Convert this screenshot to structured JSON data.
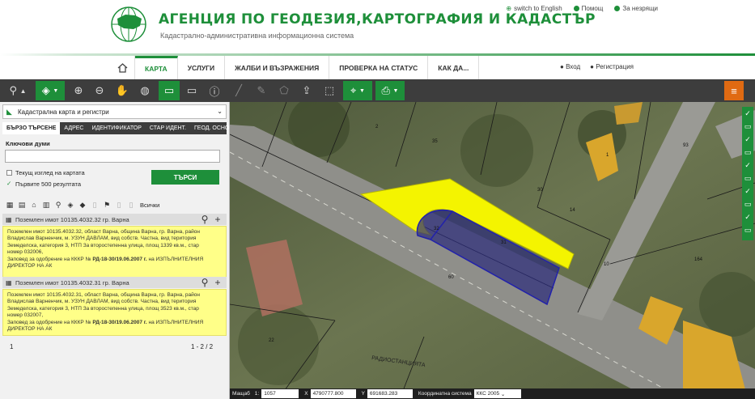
{
  "header": {
    "brand": "АГЕНЦИЯ ПО ГЕОДЕЗИЯ,КАРТОГРАФИЯ И КАДАСТЪР",
    "subtitle": "Кадастрално-административна информационна система",
    "links": [
      "switch to English",
      "Помощ",
      "За незрящи"
    ]
  },
  "nav": {
    "items": [
      "КАРТА",
      "УСЛУГИ",
      "ЖАЛБИ И ВЪЗРАЖЕНИЯ",
      "ПРОВЕРКА НА СТАТУС",
      "КАК ДА..."
    ],
    "login": "Вход",
    "register": "Регистрация"
  },
  "toolbar": {
    "icons": [
      "search-icon",
      "layers-icon",
      "zoom-in-icon",
      "zoom-out-icon",
      "pan-hand-icon",
      "globe-icon",
      "select-rect-icon",
      "select-icon",
      "info-icon",
      "measure-line-icon",
      "ruler-icon",
      "measure-area-icon",
      "upload-icon",
      "clear-selection-icon",
      "location-icon",
      "print-icon",
      "menu-icon"
    ],
    "accent": "#1e8f3a",
    "orange": "#e06a12"
  },
  "sidebar": {
    "layer_select": "Кадастрална карта и регистри",
    "tabs": [
      "БЪРЗО ТЪРСЕНЕ",
      "АДРЕС",
      "ИДЕНТИФИКАТОР",
      "СТАР ИДЕНТ.",
      "ГЕОД. ОСНОВА"
    ],
    "keywords_label": "Ключови думи",
    "current_view_label": "Текущ изглед на картата",
    "first500_label": "Първите 500 резултата",
    "search_button": "ТЪРСИ",
    "all_label": "Всички",
    "results": [
      {
        "title": "Поземлен имот 10135.4032.32 гр. Варна",
        "line1": "Поземлен имот 10135.4032.32, област Варна, община Варна, гр. Варна, район",
        "line2": "Владислав Варненчик, м. УЗУН ДАВЛАМ, вид собств. Частна, вид територия",
        "line3": "Земеделска, категория 3, НТП За второстепенна улица, площ 1339 кв.м., стар",
        "line4": "номер 032006,",
        "line5_pre": "Заповед за одобрение на КККР №",
        "order": "РД-18-30/19.06.2007 г.",
        "line5_post": "на ИЗПЪЛНИТЕЛНИЯ",
        "line6": "ДИРЕКТОР НА АК"
      },
      {
        "title": "Поземлен имот 10135.4032.31 гр. Варна",
        "line1": "Поземлен имот 10135.4032.31, област Варна, община Варна, гр. Варна, район",
        "line2": "Владислав Варненчик, м. УЗУН ДАВЛАМ, вид собств. Частна, вид територия",
        "line3": "Земеделска, категория 3, НТП За второстепенна улица, площ 3523 кв.м., стар",
        "line4": "номер 032007,",
        "line5_pre": "Заповед за одобрение на КККР №",
        "order": "РД-18-30/19.06.2007 г.",
        "line5_post": "на ИЗПЪЛНИТЕЛНИЯ",
        "line6": "ДИРЕКТОР НА АК"
      }
    ],
    "page": "1",
    "pages": "1 - 2 / 2"
  },
  "map": {
    "parcel_labels": [
      "31",
      "32",
      "30",
      "60",
      "35",
      "93",
      "1",
      "2",
      "10",
      "164",
      "14",
      "22"
    ],
    "street_label": "РАДИОСТАНЦИЯТА",
    "highlight_color": "#f4f400",
    "selection_color": "#2222aa"
  },
  "coords": {
    "scale_label": "Мащаб",
    "scale_prefix": "1:",
    "scale": "1057",
    "x_label": "X",
    "x": "4790777.800",
    "y_label": "Y",
    "y": "691683.283",
    "system_label": "Координатна система",
    "system": "ККС 2005"
  }
}
